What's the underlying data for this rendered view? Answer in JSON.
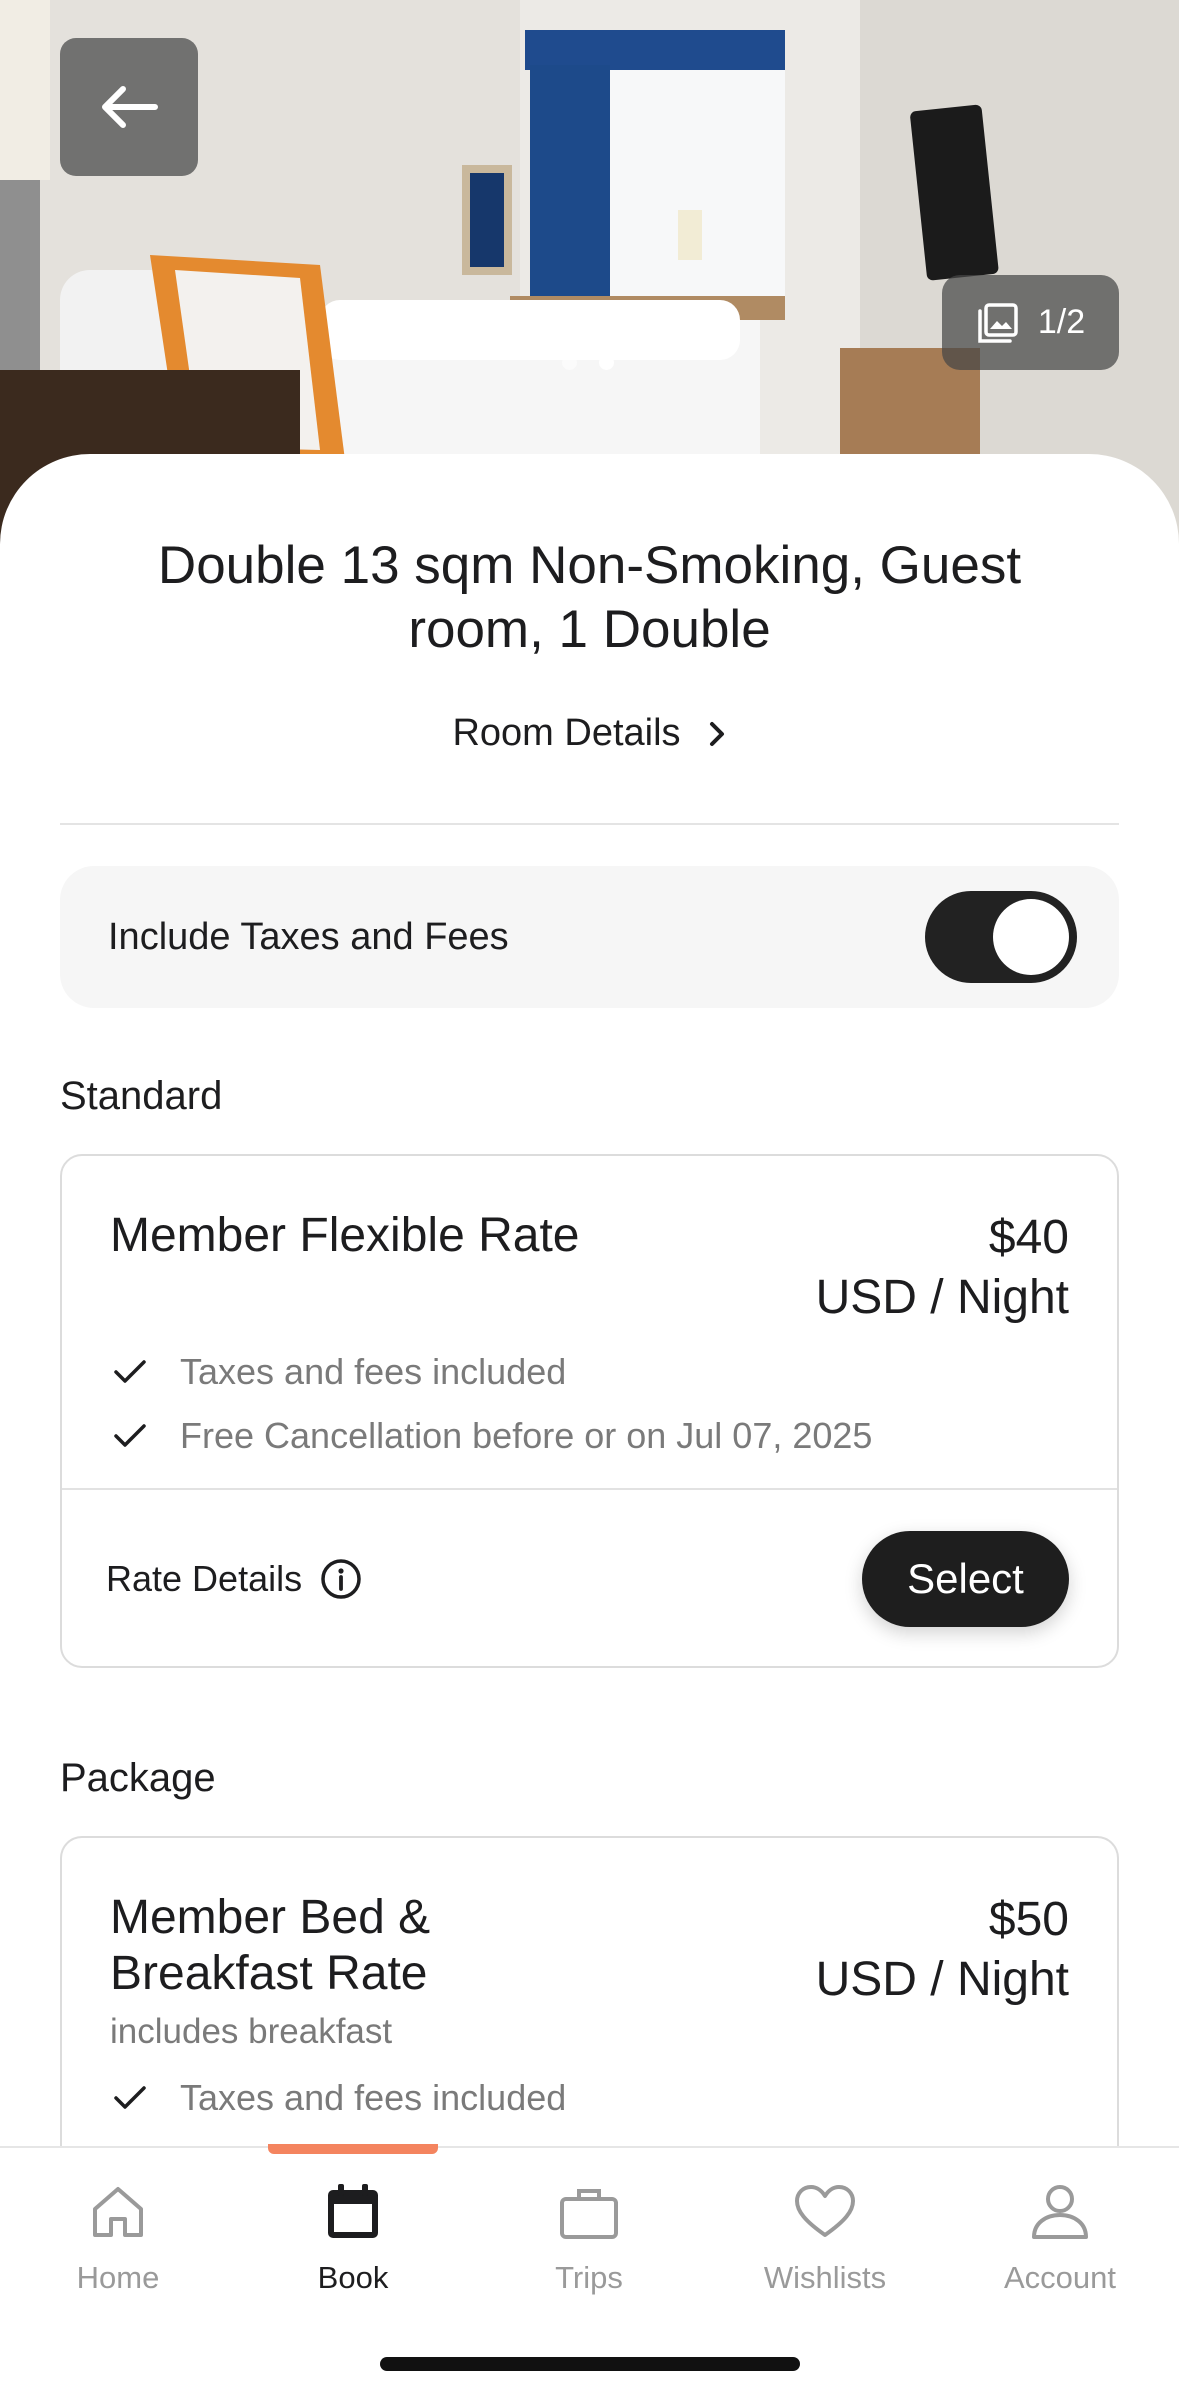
{
  "hero": {
    "photo_counter": "1/2",
    "carousel_dots": 2,
    "carousel_active_index": 1
  },
  "room": {
    "title": "Double 13 sqm Non-Smoking, Guest room, 1 Double",
    "details_link": "Room Details"
  },
  "tax_toggle": {
    "label": "Include Taxes and Fees",
    "enabled": true
  },
  "sections": {
    "standard": {
      "label": "Standard",
      "rate": {
        "name": "Member Flexible Rate",
        "price": "$40",
        "price_unit": "USD / Night",
        "features": [
          "Taxes and fees included",
          "Free Cancellation before or on Jul 07, 2025"
        ],
        "details_label": "Rate Details",
        "select_label": "Select"
      }
    },
    "package": {
      "label": "Package",
      "rate": {
        "name": "Member Bed & Breakfast Rate",
        "price": "$50",
        "price_unit": "USD / Night",
        "subtitle": "includes breakfast",
        "features": [
          "Taxes and fees included"
        ]
      }
    }
  },
  "tabbar": {
    "active": "book",
    "items": [
      {
        "id": "home",
        "label": "Home",
        "icon": "home-icon"
      },
      {
        "id": "book",
        "label": "Book",
        "icon": "calendar-icon"
      },
      {
        "id": "trips",
        "label": "Trips",
        "icon": "briefcase-icon"
      },
      {
        "id": "wishlists",
        "label": "Wishlists",
        "icon": "heart-icon"
      },
      {
        "id": "account",
        "label": "Account",
        "icon": "person-icon"
      }
    ]
  },
  "colors": {
    "accent": "#f4845f",
    "button_dark": "#1e1e1e",
    "muted_text": "#7a7a7a"
  }
}
